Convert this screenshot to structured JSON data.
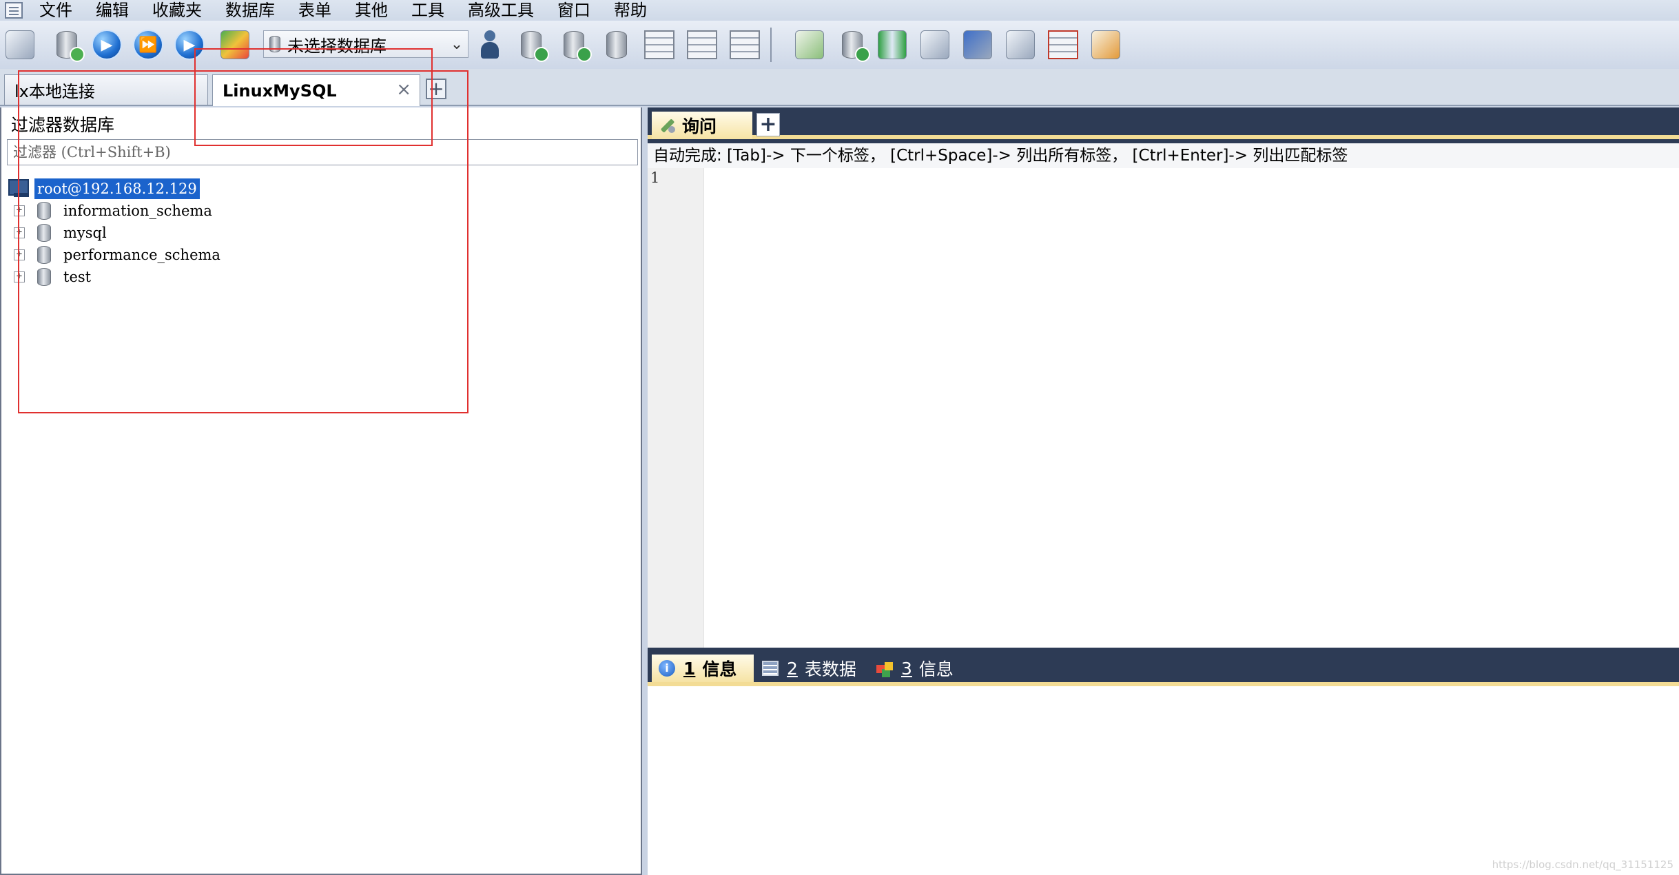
{
  "menu": [
    "文件",
    "编辑",
    "收藏夹",
    "数据库",
    "表单",
    "其他",
    "工具",
    "高级工具",
    "窗口",
    "帮助"
  ],
  "toolbar": {
    "db_select_value": "未选择数据库",
    "icons": [
      "new-connection-icon",
      "new-query-icon",
      "execute-icon",
      "execute-all-icon",
      "execute-selected-icon",
      "import-icon",
      "user-manager-icon",
      "backup-db-icon",
      "restore-db-icon",
      "copy-db-icon",
      "table-grid-icon",
      "table-grid-2-icon",
      "table-grid-3-icon",
      "sql-edit-icon",
      "db-sync-icon",
      "schema-sync-icon",
      "data-transfer-icon",
      "scheduler-icon",
      "query-builder-icon",
      "table-designer-icon",
      "schema-designer-icon"
    ]
  },
  "connection_tabs": [
    {
      "label": "lx本地连接",
      "active": false
    },
    {
      "label": "LinuxMySQL",
      "active": true
    }
  ],
  "left_panel": {
    "filter_label": "过滤器数据库",
    "filter_placeholder": "过滤器 (Ctrl+Shift+B)",
    "root": "root@192.168.12.129",
    "databases": [
      "information_schema",
      "mysql",
      "performance_schema",
      "test"
    ]
  },
  "query": {
    "tab_label": "询问",
    "autocomplete_hint": "自动完成: [Tab]-> 下一个标签， [Ctrl+Space]-> 列出所有标签， [Ctrl+Enter]-> 列出匹配标签",
    "line_number": "1"
  },
  "results_tabs": [
    {
      "num": "1",
      "label": "信息",
      "active": true
    },
    {
      "num": "2",
      "label": "表数据",
      "active": false
    },
    {
      "num": "3",
      "label": "信息",
      "active": false
    }
  ],
  "watermark": "https://blog.csdn.net/qq_31151125"
}
